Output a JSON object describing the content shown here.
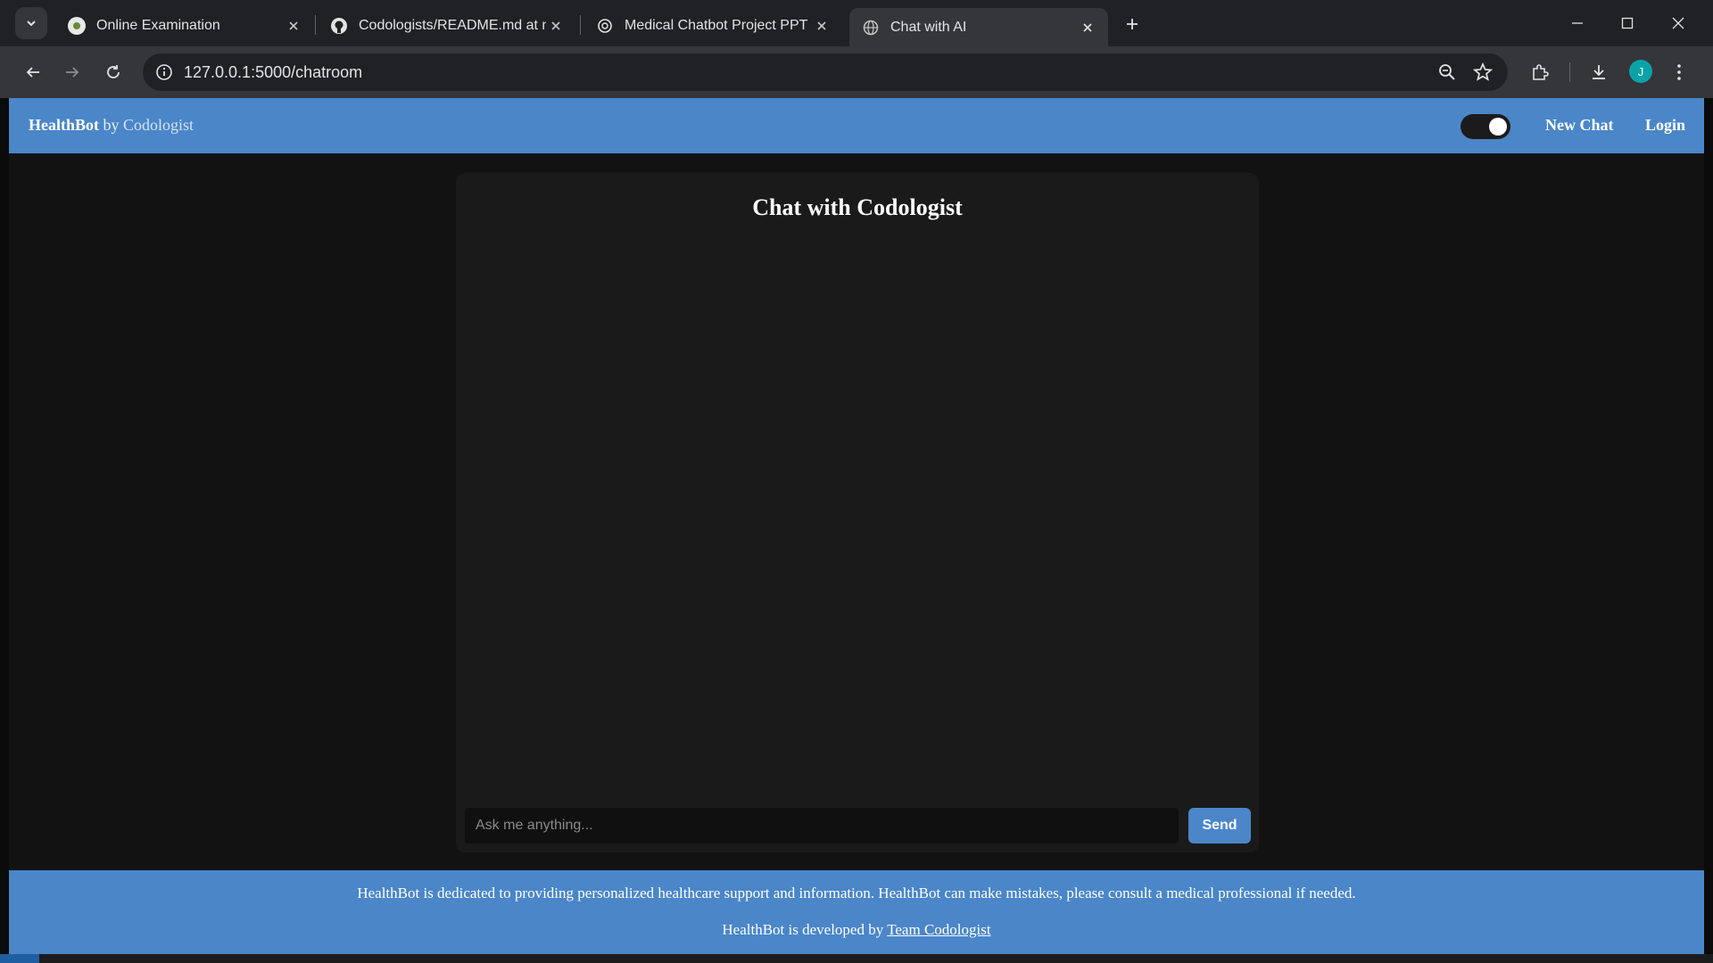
{
  "browser": {
    "tabs": [
      {
        "title": "Online Examination",
        "active": false
      },
      {
        "title": "Codologists/README.md at ma",
        "active": false
      },
      {
        "title": "Medical Chatbot Project PPT",
        "active": false
      },
      {
        "title": "Chat with AI",
        "active": true
      }
    ],
    "url": "127.0.0.1:5000/chatroom",
    "profile_initial": "J"
  },
  "navbar": {
    "brand_name": "HealthBot",
    "brand_by": "by",
    "brand_by_name": "Codologist",
    "new_chat_label": "New Chat",
    "login_label": "Login",
    "theme_toggle_on": true
  },
  "chat": {
    "title": "Chat with Codologist",
    "input_placeholder": "Ask me anything...",
    "send_label": "Send"
  },
  "footer": {
    "disclaimer": "HealthBot is dedicated to providing personalized healthcare support and information. HealthBot can make mistakes, please consult a medical professional if needed.",
    "developed_by_prefix": "HealthBot is developed by",
    "team_link": "Team Codologist"
  },
  "colors": {
    "accent": "#4a86c8",
    "page_bg": "#121212",
    "card_bg": "#1a1a1a"
  }
}
